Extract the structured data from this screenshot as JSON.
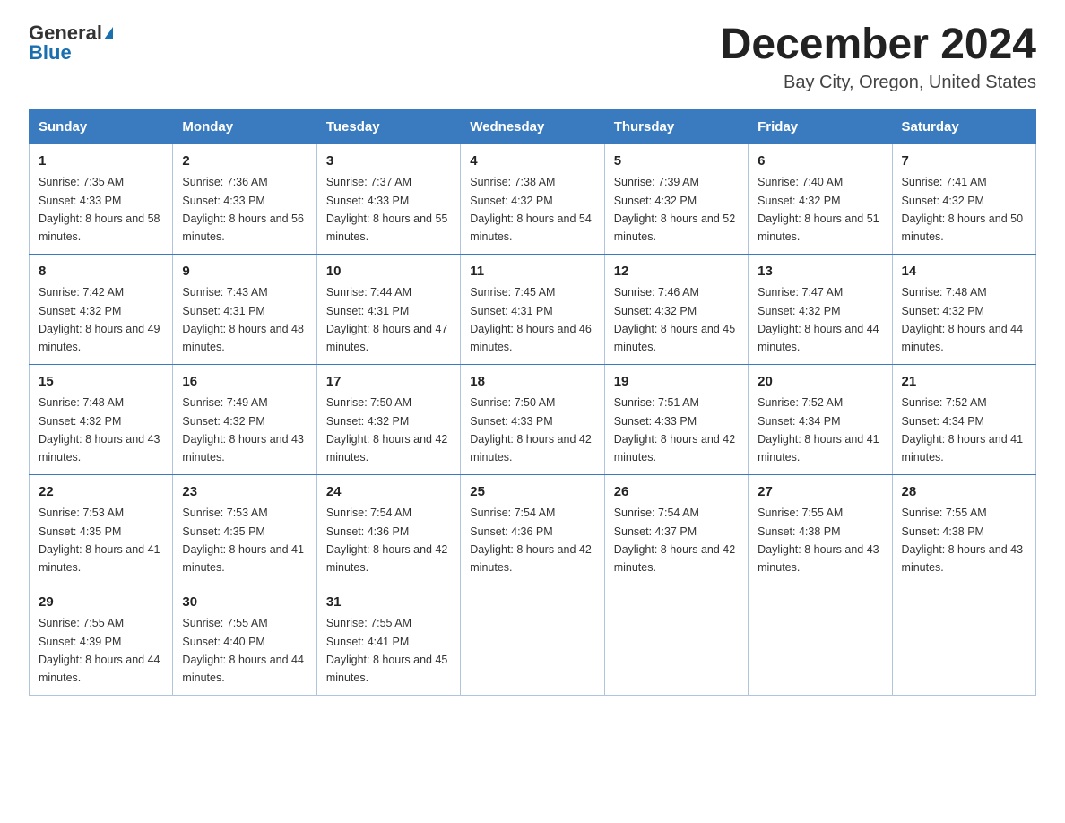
{
  "logo": {
    "general": "General",
    "triangle": "▶",
    "blue": "Blue"
  },
  "title": "December 2024",
  "subtitle": "Bay City, Oregon, United States",
  "days_of_week": [
    "Sunday",
    "Monday",
    "Tuesday",
    "Wednesday",
    "Thursday",
    "Friday",
    "Saturday"
  ],
  "weeks": [
    [
      {
        "day": "1",
        "sunrise": "7:35 AM",
        "sunset": "4:33 PM",
        "daylight": "8 hours and 58 minutes."
      },
      {
        "day": "2",
        "sunrise": "7:36 AM",
        "sunset": "4:33 PM",
        "daylight": "8 hours and 56 minutes."
      },
      {
        "day": "3",
        "sunrise": "7:37 AM",
        "sunset": "4:33 PM",
        "daylight": "8 hours and 55 minutes."
      },
      {
        "day": "4",
        "sunrise": "7:38 AM",
        "sunset": "4:32 PM",
        "daylight": "8 hours and 54 minutes."
      },
      {
        "day": "5",
        "sunrise": "7:39 AM",
        "sunset": "4:32 PM",
        "daylight": "8 hours and 52 minutes."
      },
      {
        "day": "6",
        "sunrise": "7:40 AM",
        "sunset": "4:32 PM",
        "daylight": "8 hours and 51 minutes."
      },
      {
        "day": "7",
        "sunrise": "7:41 AM",
        "sunset": "4:32 PM",
        "daylight": "8 hours and 50 minutes."
      }
    ],
    [
      {
        "day": "8",
        "sunrise": "7:42 AM",
        "sunset": "4:32 PM",
        "daylight": "8 hours and 49 minutes."
      },
      {
        "day": "9",
        "sunrise": "7:43 AM",
        "sunset": "4:31 PM",
        "daylight": "8 hours and 48 minutes."
      },
      {
        "day": "10",
        "sunrise": "7:44 AM",
        "sunset": "4:31 PM",
        "daylight": "8 hours and 47 minutes."
      },
      {
        "day": "11",
        "sunrise": "7:45 AM",
        "sunset": "4:31 PM",
        "daylight": "8 hours and 46 minutes."
      },
      {
        "day": "12",
        "sunrise": "7:46 AM",
        "sunset": "4:32 PM",
        "daylight": "8 hours and 45 minutes."
      },
      {
        "day": "13",
        "sunrise": "7:47 AM",
        "sunset": "4:32 PM",
        "daylight": "8 hours and 44 minutes."
      },
      {
        "day": "14",
        "sunrise": "7:48 AM",
        "sunset": "4:32 PM",
        "daylight": "8 hours and 44 minutes."
      }
    ],
    [
      {
        "day": "15",
        "sunrise": "7:48 AM",
        "sunset": "4:32 PM",
        "daylight": "8 hours and 43 minutes."
      },
      {
        "day": "16",
        "sunrise": "7:49 AM",
        "sunset": "4:32 PM",
        "daylight": "8 hours and 43 minutes."
      },
      {
        "day": "17",
        "sunrise": "7:50 AM",
        "sunset": "4:32 PM",
        "daylight": "8 hours and 42 minutes."
      },
      {
        "day": "18",
        "sunrise": "7:50 AM",
        "sunset": "4:33 PM",
        "daylight": "8 hours and 42 minutes."
      },
      {
        "day": "19",
        "sunrise": "7:51 AM",
        "sunset": "4:33 PM",
        "daylight": "8 hours and 42 minutes."
      },
      {
        "day": "20",
        "sunrise": "7:52 AM",
        "sunset": "4:34 PM",
        "daylight": "8 hours and 41 minutes."
      },
      {
        "day": "21",
        "sunrise": "7:52 AM",
        "sunset": "4:34 PM",
        "daylight": "8 hours and 41 minutes."
      }
    ],
    [
      {
        "day": "22",
        "sunrise": "7:53 AM",
        "sunset": "4:35 PM",
        "daylight": "8 hours and 41 minutes."
      },
      {
        "day": "23",
        "sunrise": "7:53 AM",
        "sunset": "4:35 PM",
        "daylight": "8 hours and 41 minutes."
      },
      {
        "day": "24",
        "sunrise": "7:54 AM",
        "sunset": "4:36 PM",
        "daylight": "8 hours and 42 minutes."
      },
      {
        "day": "25",
        "sunrise": "7:54 AM",
        "sunset": "4:36 PM",
        "daylight": "8 hours and 42 minutes."
      },
      {
        "day": "26",
        "sunrise": "7:54 AM",
        "sunset": "4:37 PM",
        "daylight": "8 hours and 42 minutes."
      },
      {
        "day": "27",
        "sunrise": "7:55 AM",
        "sunset": "4:38 PM",
        "daylight": "8 hours and 43 minutes."
      },
      {
        "day": "28",
        "sunrise": "7:55 AM",
        "sunset": "4:38 PM",
        "daylight": "8 hours and 43 minutes."
      }
    ],
    [
      {
        "day": "29",
        "sunrise": "7:55 AM",
        "sunset": "4:39 PM",
        "daylight": "8 hours and 44 minutes."
      },
      {
        "day": "30",
        "sunrise": "7:55 AM",
        "sunset": "4:40 PM",
        "daylight": "8 hours and 44 minutes."
      },
      {
        "day": "31",
        "sunrise": "7:55 AM",
        "sunset": "4:41 PM",
        "daylight": "8 hours and 45 minutes."
      },
      null,
      null,
      null,
      null
    ]
  ],
  "sunrise_label": "Sunrise:",
  "sunset_label": "Sunset:",
  "daylight_label": "Daylight:"
}
